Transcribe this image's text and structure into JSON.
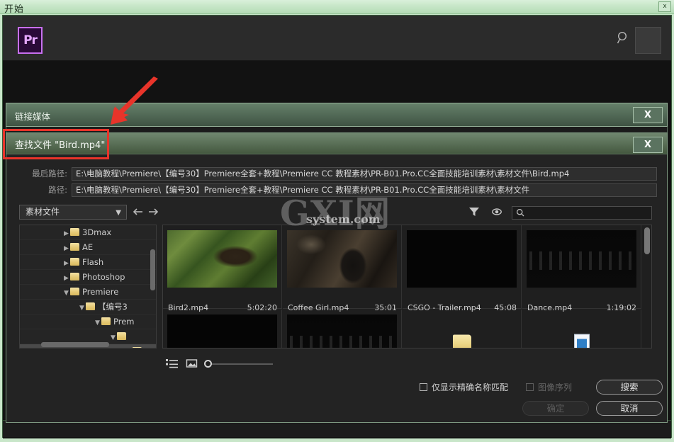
{
  "os_window": {
    "title": "开始",
    "close_label": "x"
  },
  "app": {
    "logo_text": "Pr",
    "search_icon": "search-icon"
  },
  "link_media_dialog": {
    "title": "链接媒体",
    "close_label": "X"
  },
  "find_file_dialog": {
    "title": "查找文件  \"Bird.mp4\"",
    "close_label": "X",
    "paths": [
      {
        "label": "最后路径:",
        "value": "E:\\电脑教程\\Premiere\\【编号30】Premiere全套+教程\\Premiere  CC 教程素材\\PR-B01.Pro.CC全面技能培训素材\\素材文件\\Bird.mp4"
      },
      {
        "label": "路径:",
        "value": "E:\\电脑教程\\Premiere\\【编号30】Premiere全套+教程\\Premiere  CC 教程素材\\PR-B01.Pro.CC全面技能培训素材\\素材文件"
      }
    ],
    "toolbar": {
      "location_combo": "素材文件",
      "back_icon": "arrow-left-icon",
      "forward_icon": "arrow-right-icon",
      "filter_icon": "funnel-icon",
      "visibility_icon": "eye-icon",
      "search_icon": "magnifier-icon",
      "search_value": "",
      "search_placeholder": ""
    },
    "tree": [
      {
        "label": "3Dmax",
        "indent": 0,
        "twisty": "collapsed",
        "selected": false
      },
      {
        "label": "AE",
        "indent": 0,
        "twisty": "collapsed",
        "selected": false
      },
      {
        "label": "Flash",
        "indent": 0,
        "twisty": "collapsed",
        "selected": false
      },
      {
        "label": "Photoshop",
        "indent": 0,
        "twisty": "collapsed",
        "selected": false
      },
      {
        "label": "Premiere",
        "indent": 0,
        "twisty": "expanded",
        "selected": false
      },
      {
        "label": "【编号3",
        "indent": 1,
        "twisty": "expanded",
        "selected": false
      },
      {
        "label": "Prem",
        "indent": 2,
        "twisty": "expanded",
        "selected": false
      },
      {
        "label": "",
        "indent": 3,
        "twisty": "expanded",
        "selected": false
      },
      {
        "label": "",
        "indent": 4,
        "twisty": "collapsed",
        "selected": true
      }
    ],
    "thumbnails": [
      {
        "name": "Bird2.mp4",
        "duration": "5:02:20",
        "art": "bird"
      },
      {
        "name": "Coffee Girl.mp4",
        "duration": "35:01",
        "art": "girl"
      },
      {
        "name": "CSGO - Trailer.mp4",
        "duration": "45:08",
        "art": "black"
      },
      {
        "name": "Dance.mp4",
        "duration": "1:19:02",
        "art": "dance"
      },
      {
        "name": "",
        "duration": "",
        "art": "black"
      },
      {
        "name": "",
        "duration": "",
        "art": "dance"
      },
      {
        "name": "",
        "duration": "",
        "art": "folder"
      },
      {
        "name": "",
        "duration": "",
        "art": "media"
      }
    ],
    "view_bar": {
      "list_view_icon": "list-view-icon",
      "thumbnail_view_icon": "thumbnail-view-icon",
      "zoom_slider": "zoom-slider"
    },
    "footer": {
      "exact_match_label": "仅显示精确名称匹配",
      "image_sequence_label": "图像序列",
      "search_button": "搜索",
      "ok_button": "确定",
      "cancel_button": "取消"
    }
  },
  "watermark": {
    "main": "GXI网",
    "sub": "system.com"
  },
  "colors": {
    "accent_purple": "#c86ff0",
    "annotation_red": "#e8342a",
    "frame_green": "#c3e4c4"
  }
}
